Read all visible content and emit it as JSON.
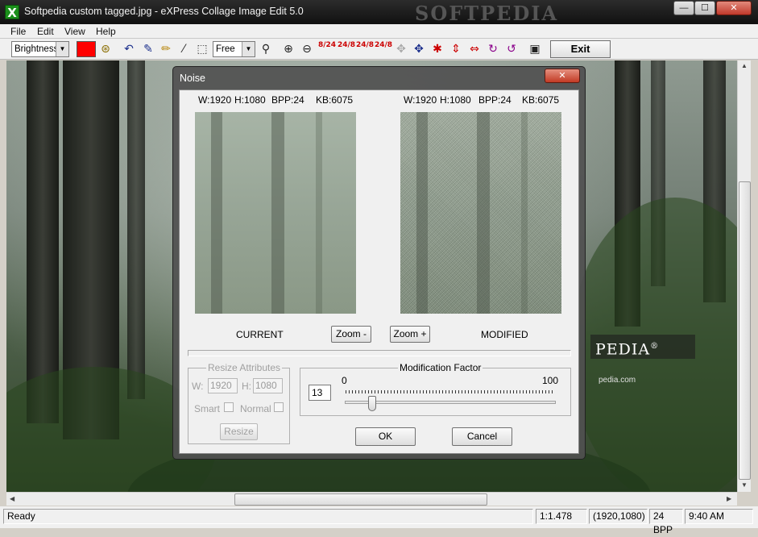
{
  "window": {
    "title": "Softpedia custom tagged.jpg - eXPress Collage Image Edit 5.0",
    "watermark": "SOFTPEDIA",
    "app_icon": "X",
    "controls": {
      "minimize": "—",
      "maximize": "☐",
      "close": "✕"
    }
  },
  "menu": [
    "File",
    "Edit",
    "View",
    "Help"
  ],
  "toolbar": {
    "effect_select": "Brightness",
    "accent_color": "#ff0000",
    "shape_select": "Free",
    "zoom_steps": [
      "8/24",
      "24/8",
      "24/8",
      "24/8"
    ],
    "exit_label": "Exit"
  },
  "canvas": {
    "logo_text": "PEDIA",
    "logo_reg": "®",
    "url_text": "pedia.com"
  },
  "dialog": {
    "title": "Noise",
    "close_glyph": "✕",
    "current": {
      "w": "W:1920",
      "h": "H:1080",
      "bpp": "BPP:24",
      "kb": "KB:6075",
      "label": "CURRENT"
    },
    "modified": {
      "w": "W:1920",
      "h": "H:1080",
      "bpp": "BPP:24",
      "kb": "KB:6075",
      "label": "MODIFIED"
    },
    "zoom_minus": "Zoom -",
    "zoom_plus": "Zoom +",
    "resize": {
      "legend": "Resize Attributes",
      "w_label": "W:",
      "w_value": "1920",
      "h_label": "H:",
      "h_value": "1080",
      "smart_label": "Smart",
      "normal_label": "Normal",
      "button": "Resize"
    },
    "modification": {
      "legend": "Modification Factor",
      "value": "13",
      "min": "0",
      "max": "100",
      "slider_value": 13
    },
    "ok": "OK",
    "cancel": "Cancel"
  },
  "status": {
    "text": "Ready",
    "zoom": "1:1.478",
    "dims": "(1920,1080)",
    "bpp": "24 BPP",
    "time": "9:40 AM"
  }
}
